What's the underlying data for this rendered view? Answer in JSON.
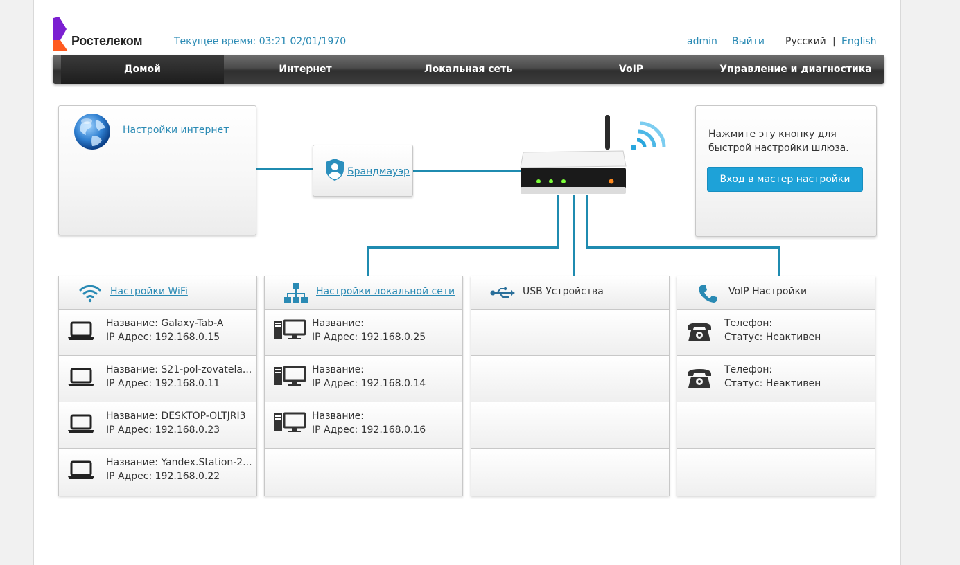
{
  "brand": {
    "name": "Ростелеком",
    "accent": "#2a8ab4",
    "logo_purple": "#7b1fd1",
    "logo_orange": "#ff5a1f"
  },
  "header": {
    "time_label": "Текущее время:",
    "time_value": "03:21 02/01/1970",
    "user": "admin",
    "logout": "Выйти",
    "lang_ru": "Русский",
    "lang_sep": "|",
    "lang_en": "English"
  },
  "nav": {
    "items": [
      {
        "label": "Домой",
        "active": true
      },
      {
        "label": "Интернет",
        "active": false
      },
      {
        "label": "Локальная сеть",
        "active": false
      },
      {
        "label": "VoIP",
        "active": false
      },
      {
        "label": "Управление и диагностика",
        "active": false
      }
    ]
  },
  "internet": {
    "link": "Настройки интернет",
    "icon": "globe-icon"
  },
  "firewall": {
    "link": "Брандмауэр",
    "icon": "shield-user-icon"
  },
  "wizard": {
    "text_line1": "Нажмите эту кнопку для",
    "text_line2": "быстрой настройки шлюза.",
    "button": "Вход в мастер настройки"
  },
  "wifi": {
    "title": "Настройки WiFi",
    "icon": "wifi-icon",
    "devices": [
      {
        "name": "Название: Galaxy-Tab-A",
        "ip": "IP Адрес: 192.168.0.15"
      },
      {
        "name": "Название: S21-pol-zovatela...",
        "ip": "IP Адрес: 192.168.0.11"
      },
      {
        "name": "Название: DESKTOP-OLTJRI3",
        "ip": "IP Адрес: 192.168.0.23"
      },
      {
        "name": "Название: Yandex.Station-2...",
        "ip": "IP Адрес: 192.168.0.22"
      }
    ]
  },
  "lan": {
    "title": "Настройки локальной сети",
    "icon": "network-icon",
    "devices": [
      {
        "name": "Название:",
        "ip": "IP Адрес: 192.168.0.25"
      },
      {
        "name": "Название:",
        "ip": "IP Адрес: 192.168.0.14"
      },
      {
        "name": "Название:",
        "ip": "IP Адрес: 192.168.0.16"
      }
    ]
  },
  "usb": {
    "title": "USB Устройства",
    "icon": "usb-icon"
  },
  "voip": {
    "title": "VoIP Настройки",
    "icon": "phone-icon",
    "lines": [
      {
        "phone": "Телефон:",
        "status": "Статус: Неактивен"
      },
      {
        "phone": "Телефон:",
        "status": "Статус: Неактивен"
      }
    ]
  }
}
